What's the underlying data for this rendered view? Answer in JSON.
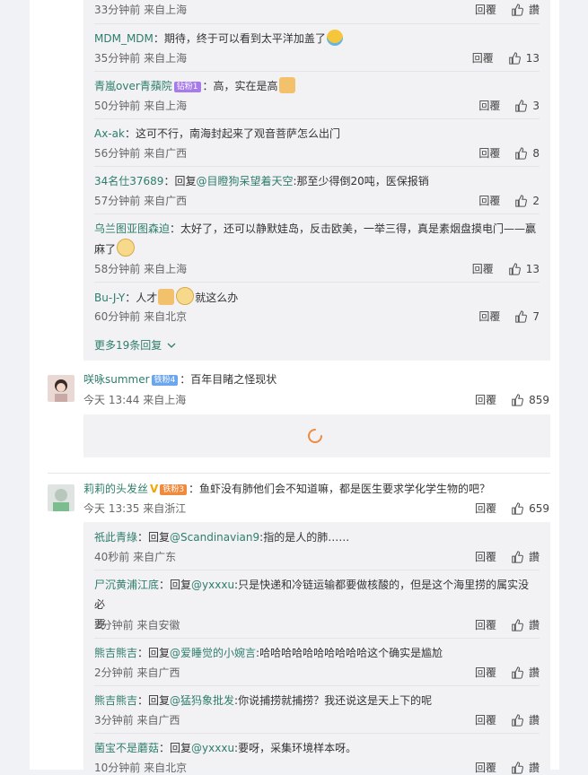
{
  "labels": {
    "reply": "回覆",
    "like": "讚",
    "reply_alt": "回复"
  },
  "thread1": {
    "replies": [
      {
        "meta": "33分钟前 来自上海",
        "likes": "讚",
        "reply": "回覆"
      },
      {
        "nick": "MDM_MDM",
        "text": "：期待，终于可以看到太平洋加盖了",
        "emoji": "crying-face-icon",
        "meta": "35分钟前 来自上海",
        "reply": "回覆",
        "likes": "13"
      },
      {
        "nick": "青嵐over青蘋院",
        "badge": "钻粉1",
        "text": "：高，实在是高",
        "emoji": "thumbs-up-emoji-icon",
        "meta": "50分钟前 来自上海",
        "reply": "回覆",
        "likes": "3"
      },
      {
        "nick": "Ax-ak",
        "text": "：这可不行，南海封起来了观音菩萨怎么出门",
        "meta": "56分钟前 来自广西",
        "reply": "回覆",
        "likes": "8"
      },
      {
        "nick": "34名仕37689",
        "text": "：回复",
        "mention": "@目瞪狗呆望着天空",
        "text2": ":那至少得倒20吨，医保报销",
        "meta": "57分钟前 来自广西",
        "reply": "回覆",
        "likes": "2"
      },
      {
        "nick": "乌兰图亚图森迫",
        "text": "：太好了，还可以静默娃岛，反击欧美，一举三得，真是素烟盘摸电门——赢",
        "text_line2": "麻了",
        "meta": "58分钟前 来自上海",
        "reply": "回覆",
        "likes": "13"
      },
      {
        "nick": "Bu-J-Y",
        "text": "：人才",
        "text2": "就这么办",
        "meta": "60分钟前 来自北京",
        "reply": "回覆",
        "likes": "7"
      }
    ],
    "more": "更多19条回复"
  },
  "comment2": {
    "nick": "咲咏summer",
    "badge": "铁粉4",
    "text": "：百年目睹之怪现状",
    "meta": "今天 13:44 来自上海",
    "reply": "回覆",
    "likes": "859"
  },
  "comment3": {
    "nick": "莉莉的头发丝",
    "vip": "V",
    "badge": "铁粉3",
    "text": "：鱼虾没有肺他们会不知道嘛，都是医生要求学化学生物的吧？",
    "meta": "今天 13:35 来自浙江",
    "reply": "回覆",
    "likes": "659",
    "replies": [
      {
        "nick": "祇此青綠",
        "text": "：回复",
        "mention": "@Scandinavian9",
        "text2": ":指的是人的肺……",
        "meta": "40秒前 来自广东",
        "reply": "回覆",
        "likes": "讚"
      },
      {
        "nick": "尸沉黄浦江底",
        "text": "：回复",
        "mention": "@yxxxu",
        "text2": ":只是快递和冷链运输都要做核酸的，但是这个海里捞的属实没必",
        "text_line2": "要",
        "meta": "2分钟前 来自安徽",
        "reply": "回覆",
        "likes": "讚"
      },
      {
        "nick": "熊吉熊吉",
        "text": "：回复",
        "mention": "@爱睡觉的小婉言",
        "text2": ":哈哈哈哈哈哈哈哈哈哈这个确实是尴尬",
        "meta": "2分钟前 来自广西",
        "reply": "回覆",
        "likes": "讚"
      },
      {
        "nick": "熊吉熊吉",
        "text": "：回复",
        "mention": "@猛犸象批发",
        "text2": ":你说捕捞就捕捞？我还说这是天上下的呢",
        "meta": "3分钟前 来自广西",
        "reply": "回覆",
        "likes": "讚"
      },
      {
        "nick": "菌宝不是蘑菇",
        "text": "：回复",
        "mention": "@yxxxu",
        "text2": ":要呀，采集环境样本呀。",
        "meta": "10分钟前 来自北京",
        "reply": "回覆",
        "likes": "讚"
      }
    ]
  }
}
